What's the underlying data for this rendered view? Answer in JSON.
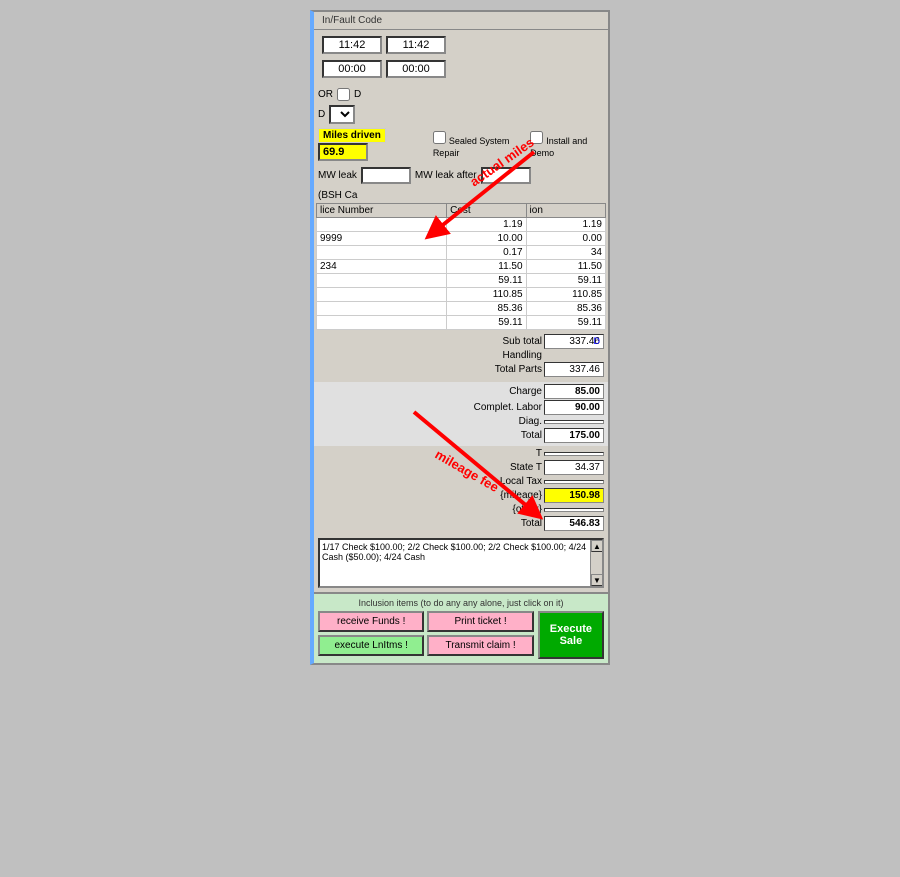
{
  "header": {
    "fault_code_label": "In/Fault Code"
  },
  "times": {
    "time1": "11:42",
    "time2": "11:42",
    "time3": "00:00",
    "time4": "00:00"
  },
  "or_section": {
    "label": "OR",
    "checkbox_label": ""
  },
  "id_fields": {
    "d_label": "D",
    "d2_label": "D"
  },
  "miles": {
    "label": "Miles driven",
    "value": "69.9",
    "sealed_label": "Sealed System Repair",
    "install_label": "Install and Demo"
  },
  "mw": {
    "leak_label": "MW leak",
    "leak_after_label": "MW leak after"
  },
  "bsh": {
    "label": "(BSH Ca"
  },
  "table": {
    "headers": [
      "lice Number",
      "Cost",
      "ion"
    ],
    "rows": [
      {
        "num": "",
        "cost": "1.19",
        "val": "1.19"
      },
      {
        "num": "9999",
        "cost": "10.00",
        "val": "0.00"
      },
      {
        "num": "",
        "cost": "0.17",
        "val": "34"
      },
      {
        "num": "234",
        "cost": "11.50",
        "val": "11.50"
      },
      {
        "num": "",
        "cost": "59.11",
        "val": "59.11"
      },
      {
        "num": "",
        "cost": "110.85",
        "val": "110.85"
      },
      {
        "num": "",
        "cost": "85.36",
        "val": "85.36"
      },
      {
        "num": "",
        "cost": "59.11",
        "val": "59.11"
      }
    ]
  },
  "subtotals": {
    "sub_total_label": "Sub total",
    "sub_total_value": "337.46",
    "handling_label": "Handling",
    "handling_value": "",
    "total_parts_label": "Total Parts",
    "total_parts_value": "337.46",
    "d_badge": "D"
  },
  "labor": {
    "charge_label": "Charge",
    "charge_value": "85.00",
    "complete_labor_label": "Complet. Labor",
    "complete_labor_value": "90.00",
    "diag_label": "Diag.",
    "diag_value": "",
    "total_label": "Total",
    "total_value": "175.00"
  },
  "taxes": {
    "t_label": "T",
    "t_value": "",
    "state_tax_label": "State T",
    "state_tax_value": "34.37",
    "local_tax_label": "Local Tax",
    "mileage_label": "{mileage}",
    "mileage_value": "150.98",
    "other_label": "{other}",
    "other_value": "",
    "total_label": "Total",
    "total_value": "546.83"
  },
  "payments": {
    "text": "1/17 Check $100.00; 2/2 Check $100.00; 2/2 Check $100.00; 4/24 Cash ($50.00); 4/24 Cash"
  },
  "annotations": {
    "actual_miles": "actual miles",
    "mileage_fee": "mileage fee"
  },
  "bottom": {
    "inclusion_label": "Inclusion items (to do any any alone, just click on it)",
    "receive_funds_label": "receive Funds !",
    "print_ticket_label": "Print ticket !",
    "execute_linitems_label": "execute LnItms !",
    "transmit_claim_label": "Transmit claim !",
    "execute_sale_label": "Execute\nSale"
  }
}
